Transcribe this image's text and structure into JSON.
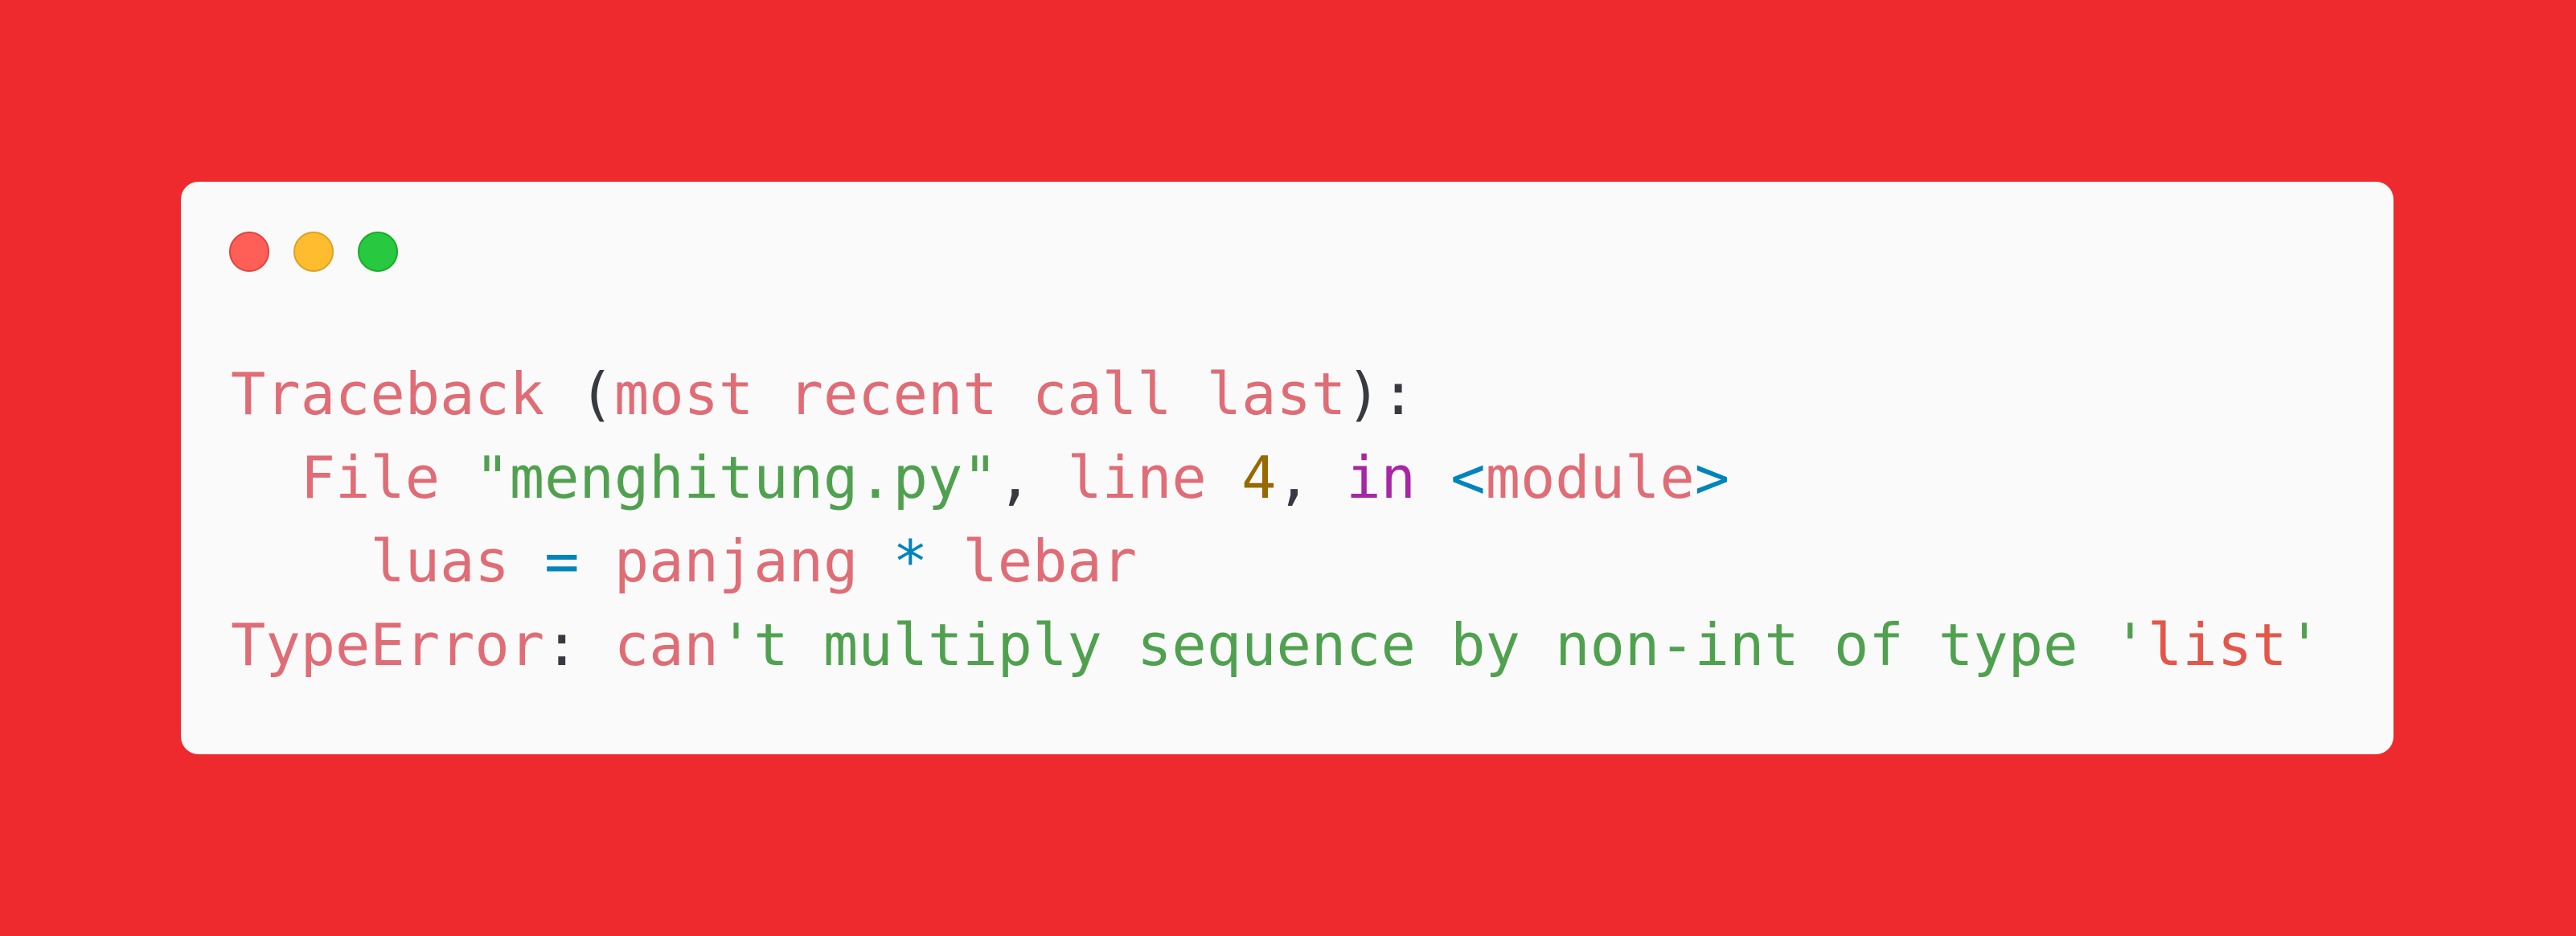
{
  "window": {
    "controls": [
      {
        "name": "close",
        "color": "#ff5f57"
      },
      {
        "name": "minimize",
        "color": "#febc2e"
      },
      {
        "name": "maximize",
        "color": "#28c840"
      }
    ]
  },
  "colors": {
    "background": "#ef2a2e",
    "window": "#fafafa",
    "identifier": "#e06c75",
    "string": "#50a14f",
    "number": "#986801",
    "keyword": "#a626a4",
    "operator": "#0184bc",
    "punctuation": "#383a42",
    "string_accent": "#e45649"
  },
  "code": {
    "lines": [
      [
        {
          "text": "Traceback",
          "color": "#e06c75"
        },
        {
          "text": " (",
          "color": "#383a42"
        },
        {
          "text": "most",
          "color": "#e06c75"
        },
        {
          "text": " ",
          "color": "#383a42"
        },
        {
          "text": "recent",
          "color": "#e06c75"
        },
        {
          "text": " ",
          "color": "#383a42"
        },
        {
          "text": "call",
          "color": "#e06c75"
        },
        {
          "text": " ",
          "color": "#383a42"
        },
        {
          "text": "last",
          "color": "#e06c75"
        },
        {
          "text": "):",
          "color": "#383a42"
        }
      ],
      [
        {
          "text": "  ",
          "color": "#383a42"
        },
        {
          "text": "File",
          "color": "#e06c75"
        },
        {
          "text": " ",
          "color": "#383a42"
        },
        {
          "text": "\"menghitung.py\"",
          "color": "#50a14f"
        },
        {
          "text": ", ",
          "color": "#383a42"
        },
        {
          "text": "line",
          "color": "#e06c75"
        },
        {
          "text": " ",
          "color": "#383a42"
        },
        {
          "text": "4",
          "color": "#986801"
        },
        {
          "text": ", ",
          "color": "#383a42"
        },
        {
          "text": "in",
          "color": "#a626a4"
        },
        {
          "text": " ",
          "color": "#383a42"
        },
        {
          "text": "<",
          "color": "#0184bc"
        },
        {
          "text": "module",
          "color": "#e06c75"
        },
        {
          "text": ">",
          "color": "#0184bc"
        }
      ],
      [
        {
          "text": "    ",
          "color": "#383a42"
        },
        {
          "text": "luas",
          "color": "#e06c75"
        },
        {
          "text": " ",
          "color": "#383a42"
        },
        {
          "text": "=",
          "color": "#0184bc"
        },
        {
          "text": " ",
          "color": "#383a42"
        },
        {
          "text": "panjang",
          "color": "#e06c75"
        },
        {
          "text": " ",
          "color": "#383a42"
        },
        {
          "text": "*",
          "color": "#0184bc"
        },
        {
          "text": " ",
          "color": "#383a42"
        },
        {
          "text": "lebar",
          "color": "#e06c75"
        }
      ],
      [
        {
          "text": "TypeError",
          "color": "#e06c75"
        },
        {
          "text": ": ",
          "color": "#383a42"
        },
        {
          "text": "can",
          "color": "#e06c75"
        },
        {
          "text": "'t multiply sequence by non-int of type '",
          "color": "#50a14f"
        },
        {
          "text": "list",
          "color": "#e45649"
        },
        {
          "text": "'",
          "color": "#50a14f"
        }
      ]
    ]
  }
}
